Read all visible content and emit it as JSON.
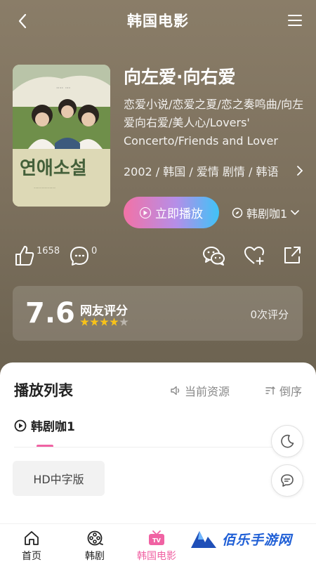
{
  "header": {
    "title": "韩国电影"
  },
  "movie": {
    "title": "向左爱·向右爱",
    "aka": "恋爱小说/恋爱之夏/恋之奏鸣曲/向左爱向右爱/美人心/Lovers' Concerto/Friends and Lover",
    "meta": "2002 / 韩国 / 爱情 剧情 / 韩语",
    "poster_text": "연애소설"
  },
  "play": {
    "label": "立即播放"
  },
  "source_selector": {
    "label": "韩剧咖1"
  },
  "actions": {
    "likes": "1658",
    "comments": "0"
  },
  "rating": {
    "score": "7.6",
    "label": "网友评分",
    "stars": 4,
    "max_stars": 5,
    "count": "0次评分"
  },
  "playlist": {
    "title": "播放列表",
    "current_source": "当前资源",
    "order": "倒序",
    "source_tab": "韩剧咖1",
    "episodes": [
      "HD中字版"
    ]
  },
  "nav": {
    "items": [
      {
        "label": "首页",
        "icon": "home-icon"
      },
      {
        "label": "韩剧",
        "icon": "film-reel-icon"
      },
      {
        "label": "韩国电影",
        "icon": "tv-icon"
      }
    ],
    "active_index": 2
  },
  "watermark": {
    "text": "佰乐手游网"
  },
  "colors": {
    "accent": "#f062a3",
    "gradient_start": "#f272a6",
    "gradient_end": "#3fc3f7",
    "star": "#f7c21a"
  }
}
